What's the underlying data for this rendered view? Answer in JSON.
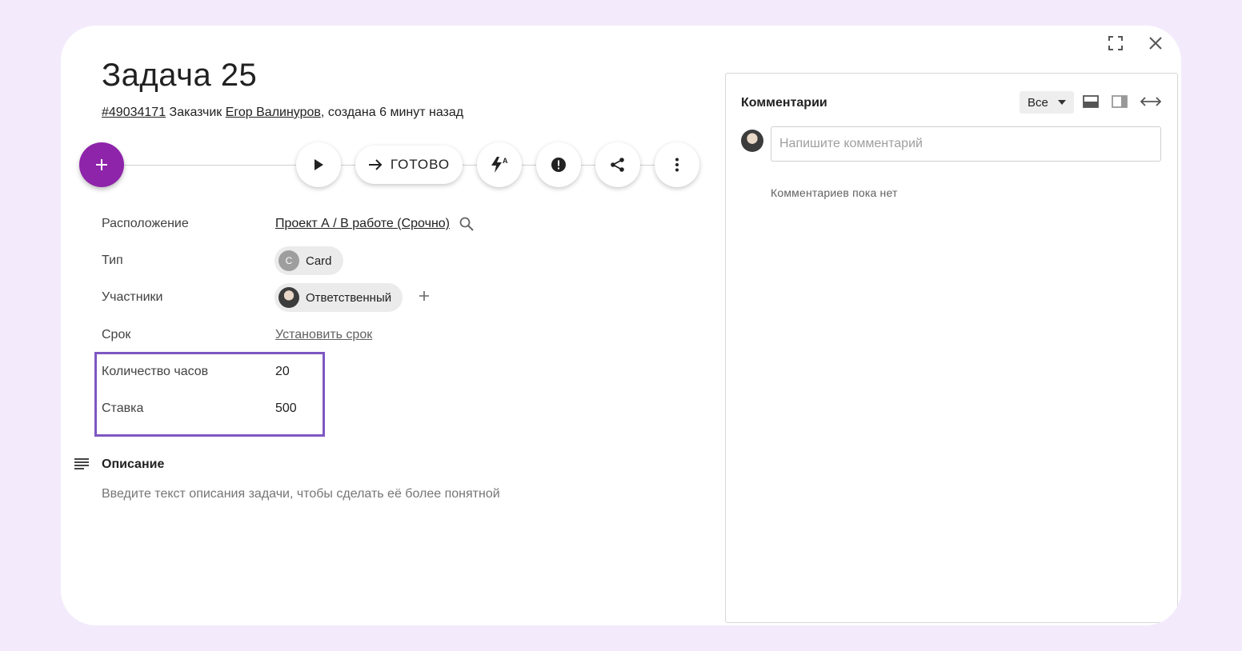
{
  "task": {
    "title": "Задача 25",
    "id": "#49034171",
    "customer_prefix": "Заказчик",
    "customer_name": "Егор Валинуров",
    "created_suffix": ", создана 6 минут назад"
  },
  "toolbar": {
    "add_icon": "plus-icon",
    "play_icon": "play-icon",
    "done_label": "ГОТОВО",
    "automation_icon": "lightning-a-icon",
    "priority_icon": "alert-icon",
    "share_icon": "share-icon",
    "more_icon": "more-vertical-icon"
  },
  "fields": {
    "location": {
      "label": "Расположение",
      "value": "Проект А / В работе (Срочно)"
    },
    "type": {
      "label": "Тип",
      "chip_letter": "C",
      "value": "Card"
    },
    "participants": {
      "label": "Участники",
      "value": "Ответственный"
    },
    "deadline": {
      "label": "Срок",
      "value": "Установить срок"
    },
    "hours": {
      "label": "Количество часов",
      "value": "20"
    },
    "rate": {
      "label": "Ставка",
      "value": "500"
    }
  },
  "description": {
    "title": "Описание",
    "placeholder": "Введите текст описания задачи, чтобы сделать её более понятной"
  },
  "comments": {
    "title": "Комментарии",
    "filter": "Все",
    "input_placeholder": "Напишите комментарий",
    "empty": "Комментариев пока нет"
  },
  "colors": {
    "accent": "#8e24aa",
    "highlight": "#7e57c2",
    "background": "#f3ebfb"
  }
}
